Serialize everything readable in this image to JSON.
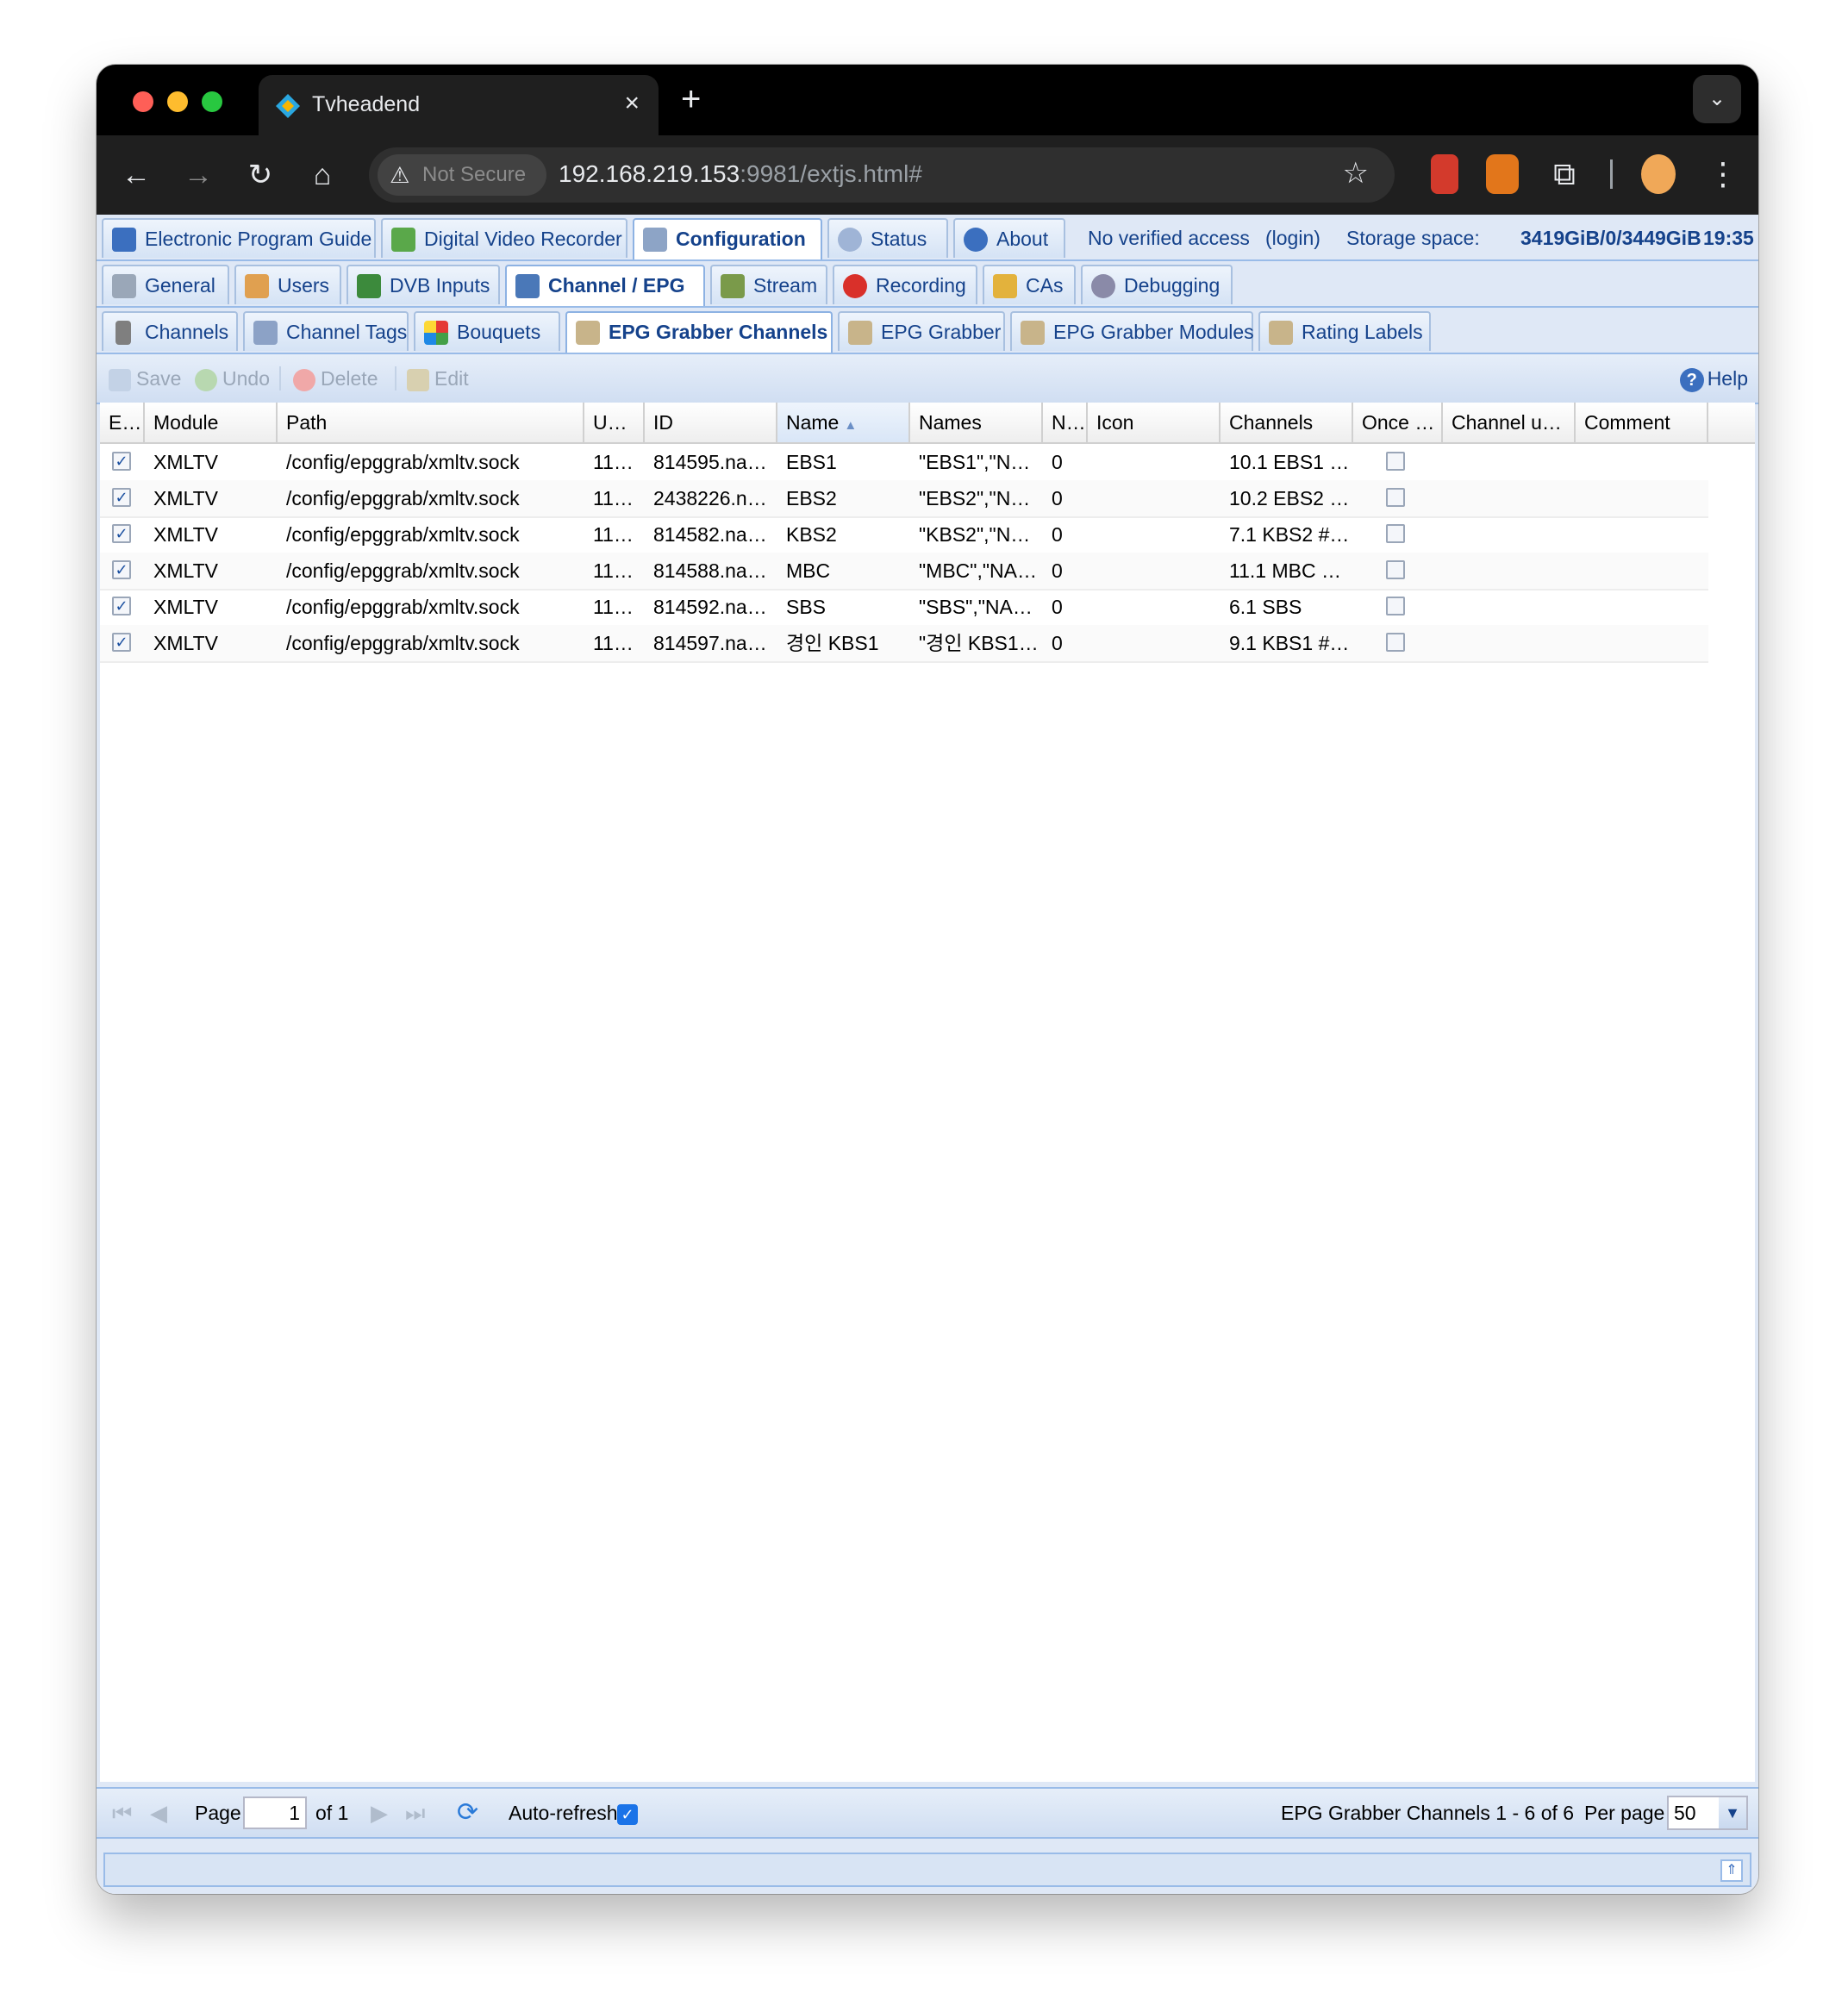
{
  "browser": {
    "tab_title": "Tvheadend",
    "security_label": "Not Secure",
    "url_host": "192.168.219.153",
    "url_rest": ":9981/extjs.html#"
  },
  "main_tabs": [
    {
      "label": "Electronic Program Guide"
    },
    {
      "label": "Digital Video Recorder"
    },
    {
      "label": "Configuration"
    },
    {
      "label": "Status"
    },
    {
      "label": "About"
    }
  ],
  "header_info": {
    "access": "No verified access",
    "login": "(login)",
    "storage_label": "Storage space:",
    "storage_value": "3419GiB/0/3449GiB",
    "time": "19:35"
  },
  "config_tabs": [
    {
      "label": "General"
    },
    {
      "label": "Users"
    },
    {
      "label": "DVB Inputs"
    },
    {
      "label": "Channel / EPG"
    },
    {
      "label": "Stream"
    },
    {
      "label": "Recording"
    },
    {
      "label": "CAs"
    },
    {
      "label": "Debugging"
    }
  ],
  "sub_tabs": [
    {
      "label": "Channels"
    },
    {
      "label": "Channel Tags"
    },
    {
      "label": "Bouquets"
    },
    {
      "label": "EPG Grabber Channels"
    },
    {
      "label": "EPG Grabber"
    },
    {
      "label": "EPG Grabber Modules"
    },
    {
      "label": "Rating Labels"
    }
  ],
  "actions": {
    "save": "Save",
    "undo": "Undo",
    "delete": "Delete",
    "edit": "Edit",
    "help": "Help"
  },
  "grid": {
    "columns": [
      "E…",
      "Module",
      "Path",
      "U…",
      "ID",
      "Name",
      "Names",
      "N…",
      "Icon",
      "Channels",
      "Once …",
      "Channel u…",
      "Comment"
    ],
    "rows": [
      {
        "enabled": true,
        "module": "XMLTV",
        "path": "/config/epggrab/xmltv.sock",
        "u": "11…",
        "id": "814595.na…",
        "name": "EBS1",
        "names": "\"EBS1\",\"N…",
        "n": "0",
        "icon": "",
        "channels": "10.1 EBS1 …",
        "once": false,
        "channel_u": "",
        "comment": ""
      },
      {
        "enabled": true,
        "module": "XMLTV",
        "path": "/config/epggrab/xmltv.sock",
        "u": "11…",
        "id": "2438226.n…",
        "name": "EBS2",
        "names": "\"EBS2\",\"N…",
        "n": "0",
        "icon": "",
        "channels": "10.2 EBS2 …",
        "once": false,
        "channel_u": "",
        "comment": ""
      },
      {
        "enabled": true,
        "module": "XMLTV",
        "path": "/config/epggrab/xmltv.sock",
        "u": "11…",
        "id": "814582.na…",
        "name": "KBS2",
        "names": "\"KBS2\",\"N…",
        "n": "0",
        "icon": "",
        "channels": "7.1 KBS2 #…",
        "once": false,
        "channel_u": "",
        "comment": ""
      },
      {
        "enabled": true,
        "module": "XMLTV",
        "path": "/config/epggrab/xmltv.sock",
        "u": "11…",
        "id": "814588.na…",
        "name": "MBC",
        "names": "\"MBC\",\"NA…",
        "n": "0",
        "icon": "",
        "channels": "11.1 MBC …",
        "once": false,
        "channel_u": "",
        "comment": ""
      },
      {
        "enabled": true,
        "module": "XMLTV",
        "path": "/config/epggrab/xmltv.sock",
        "u": "11…",
        "id": "814592.na…",
        "name": "SBS",
        "names": "\"SBS\",\"NA…",
        "n": "0",
        "icon": "",
        "channels": "6.1 SBS",
        "once": false,
        "channel_u": "",
        "comment": ""
      },
      {
        "enabled": true,
        "module": "XMLTV",
        "path": "/config/epggrab/xmltv.sock",
        "u": "11…",
        "id": "814597.na…",
        "name": "경인 KBS1",
        "names": "\"경인 KBS1…",
        "n": "0",
        "icon": "",
        "channels": "9.1 KBS1 #…",
        "once": false,
        "channel_u": "",
        "comment": ""
      }
    ]
  },
  "paging": {
    "page_label": "Page",
    "page_value": "1",
    "of_label": "of 1",
    "auto_refresh": "Auto-refresh",
    "summary": "EPG Grabber Channels 1 - 6 of 6",
    "per_page_label": "Per page",
    "per_page_value": "50"
  },
  "colors": {
    "tab_text": "#15428b",
    "tab_border": "#99bbe8",
    "app_background": "#dfe8f6"
  }
}
